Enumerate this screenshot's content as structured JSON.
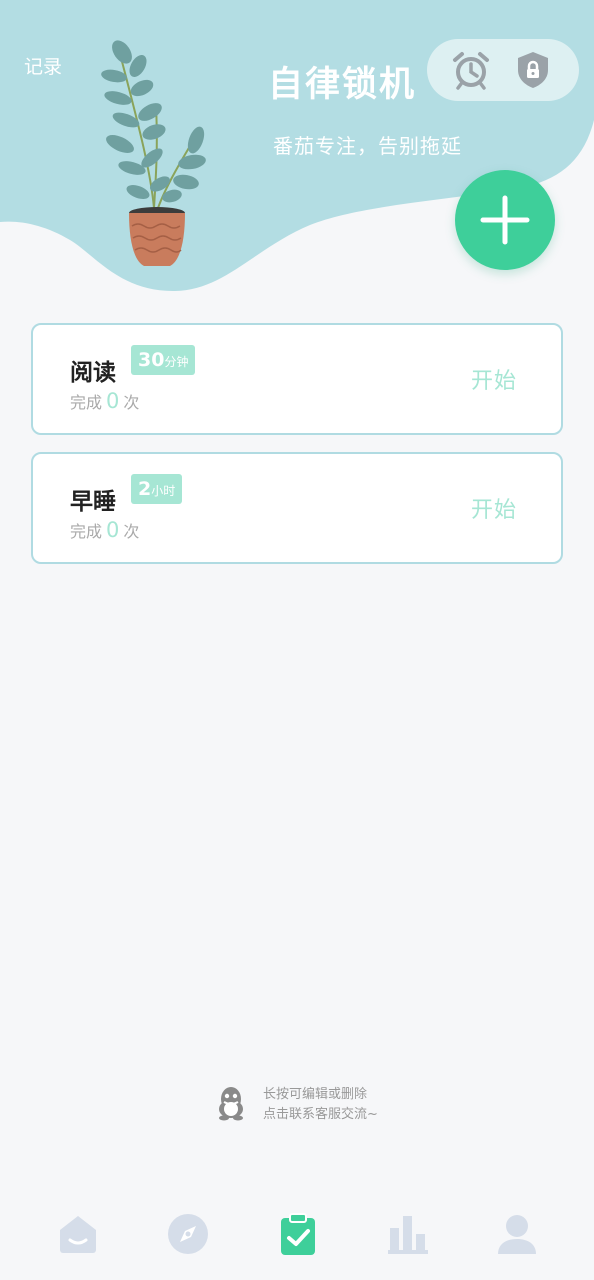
{
  "header": {
    "record_label": "记录",
    "app_title": "自律锁机",
    "subtitle": "番茄专注，告别拖延",
    "top_actions": [
      "alarm-icon",
      "shield-lock-icon"
    ],
    "add_button_icon": "plus-icon"
  },
  "tasks": [
    {
      "name": "阅读",
      "duration_value": "30",
      "duration_unit": "分钟",
      "done_prefix": "完成",
      "done_count": "0",
      "done_suffix": "次",
      "start_label": "开始"
    },
    {
      "name": "早睡",
      "duration_value": "2",
      "duration_unit": "小时",
      "done_prefix": "完成",
      "done_count": "0",
      "done_suffix": "次",
      "start_label": "开始"
    }
  ],
  "tip": {
    "icon": "qq-penguin-icon",
    "line1": "长按可编辑或删除",
    "line2": "点击联系客服交流~"
  },
  "bottom_nav": {
    "items": [
      "home-icon",
      "compass-icon",
      "clipboard-check-icon",
      "bar-chart-icon",
      "user-icon"
    ],
    "active_index": 2
  },
  "colors": {
    "header_bg": "#b3dde3",
    "accent": "#3ecf9a",
    "badge": "#a6e6d4",
    "card_border": "#b0dbe2",
    "nav_inactive": "#d5dde9"
  }
}
